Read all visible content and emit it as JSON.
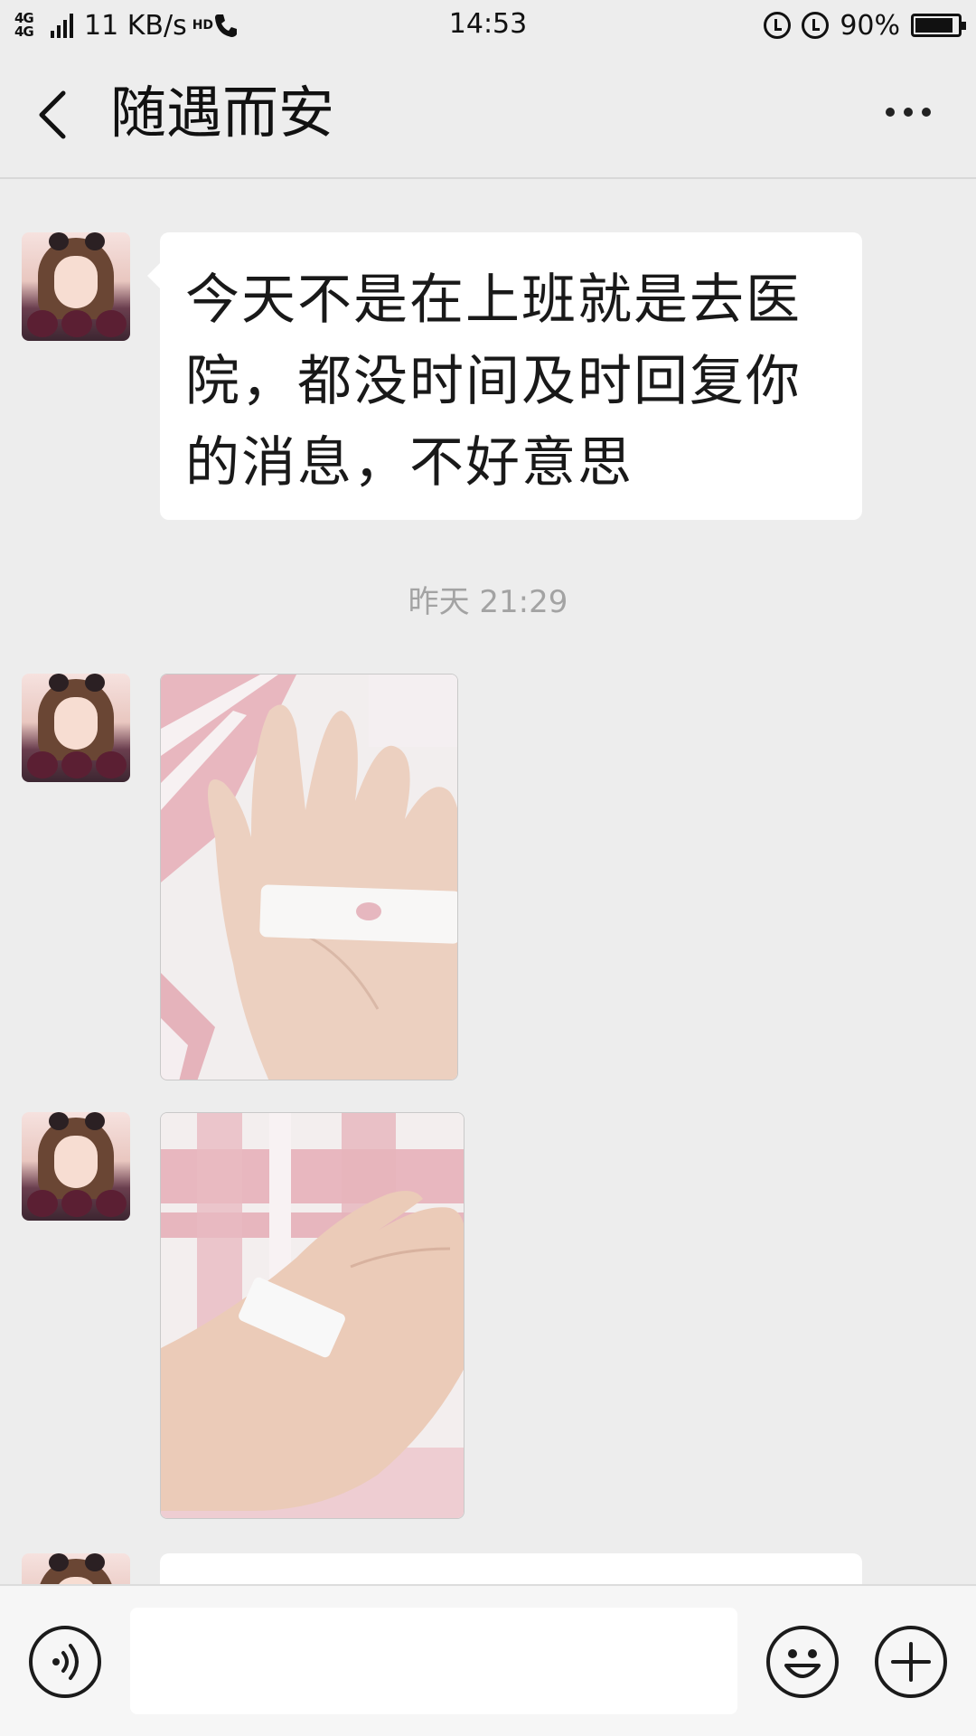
{
  "status_bar": {
    "network_type": "4G 4G",
    "speed": "11 KB/s",
    "hd_label": "HD",
    "time": "14:53",
    "battery_percent": "90%",
    "battery_level": 0.9,
    "icons": [
      "signal-icon",
      "call-icon",
      "screen-lock-icon",
      "alarm-icon",
      "battery-icon"
    ]
  },
  "header": {
    "title": "随遇而安",
    "back_icon": "chevron-left-icon",
    "more_icon": "more-dots-icon"
  },
  "chat": {
    "messages": [
      {
        "type": "text",
        "sender": "contact",
        "text": "今天不是在上班就是去医院，都没时间及时回复你的消息，不好意思"
      },
      {
        "type": "timestamp",
        "text": "昨天 21:29"
      },
      {
        "type": "image",
        "sender": "contact"
      },
      {
        "type": "image",
        "sender": "contact"
      },
      {
        "type": "text",
        "sender": "contact",
        "text": ""
      }
    ]
  },
  "input_bar": {
    "voice_icon": "voice-icon",
    "input_value": "",
    "emoji_icon": "emoji-icon",
    "plus_icon": "plus-icon"
  },
  "colors": {
    "background": "#ededed",
    "bubble": "#ffffff",
    "timestamp_text": "#a3a3a3",
    "input_bar": "#f6f6f6"
  }
}
